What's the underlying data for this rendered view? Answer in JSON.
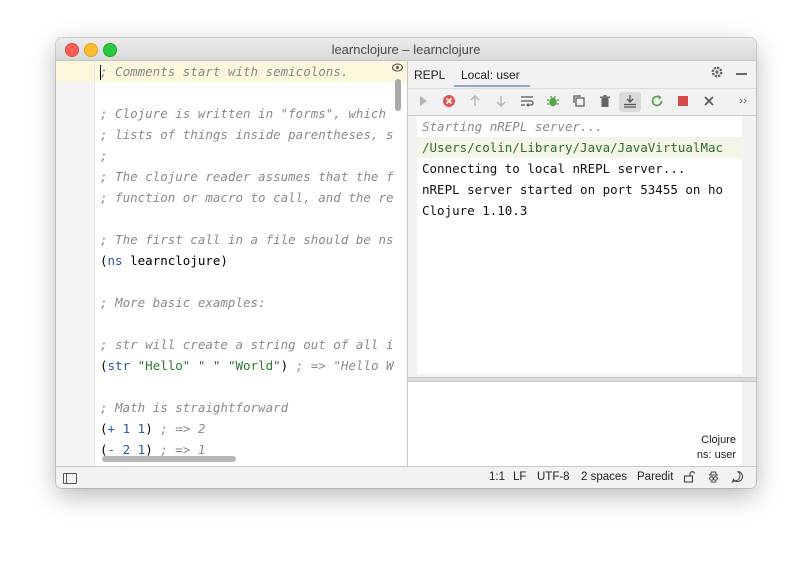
{
  "window": {
    "title": "learnclojure – learnclojure"
  },
  "editor": {
    "lines": [
      [
        {
          "c": "cm",
          "t": "; Comments start with semicolons."
        }
      ],
      [],
      [
        {
          "c": "cm",
          "t": "; Clojure is written in \"forms\", which"
        }
      ],
      [
        {
          "c": "cm",
          "t": "; lists of things inside parentheses, s"
        }
      ],
      [
        {
          "c": "cm",
          "t": ";"
        }
      ],
      [
        {
          "c": "cm",
          "t": "; The clojure reader assumes that the f"
        }
      ],
      [
        {
          "c": "cm",
          "t": "; function or macro to call, and the re"
        }
      ],
      [],
      [
        {
          "c": "cm",
          "t": "; The first call in a file should be ns"
        }
      ],
      [
        {
          "c": "p",
          "t": "("
        },
        {
          "c": "kw",
          "t": "ns"
        },
        {
          "c": "p",
          "t": " learnclojure)"
        }
      ],
      [],
      [
        {
          "c": "cm",
          "t": "; More basic examples:"
        }
      ],
      [],
      [
        {
          "c": "cm",
          "t": "; str will create a string out of all i"
        }
      ],
      [
        {
          "c": "p",
          "t": "("
        },
        {
          "c": "kw",
          "t": "str"
        },
        {
          "c": "p",
          "t": " "
        },
        {
          "c": "st",
          "t": "\"Hello\""
        },
        {
          "c": "p",
          "t": " "
        },
        {
          "c": "st",
          "t": "\" \""
        },
        {
          "c": "p",
          "t": " "
        },
        {
          "c": "st",
          "t": "\"World\""
        },
        {
          "c": "p",
          "t": ") "
        },
        {
          "c": "cm",
          "t": "; => \"Hello W"
        }
      ],
      [],
      [
        {
          "c": "cm",
          "t": "; Math is straightforward"
        }
      ],
      [
        {
          "c": "p",
          "t": "("
        },
        {
          "c": "kw",
          "t": "+"
        },
        {
          "c": "p",
          "t": " "
        },
        {
          "c": "nm",
          "t": "1"
        },
        {
          "c": "p",
          "t": " "
        },
        {
          "c": "nm",
          "t": "1"
        },
        {
          "c": "p",
          "t": ") "
        },
        {
          "c": "cm",
          "t": "; => 2"
        }
      ],
      [
        {
          "c": "p",
          "t": "("
        },
        {
          "c": "kw",
          "t": "-"
        },
        {
          "c": "p",
          "t": " "
        },
        {
          "c": "nm",
          "t": "2"
        },
        {
          "c": "p",
          "t": " "
        },
        {
          "c": "nm",
          "t": "1"
        },
        {
          "c": "p",
          "t": ") "
        },
        {
          "c": "cm",
          "t": "; => 1"
        }
      ]
    ]
  },
  "repl": {
    "tab_repl": "REPL",
    "tab_local": "Local: user",
    "toolbar_icons": [
      "run-icon",
      "stop-error-icon",
      "arrow-up-icon",
      "arrow-down-icon",
      "soft-wrap-icon",
      "debug-bug-icon",
      "copy-icon",
      "trash-icon",
      "scroll-to-end-icon",
      "reload-icon",
      "stop-icon",
      "close-icon",
      "more-icon"
    ],
    "output": [
      {
        "style": "o-italic",
        "text": "Starting nREPL server..."
      },
      {
        "style": "o-path",
        "text": "/Users/colin/Library/Java/JavaVirtualMac"
      },
      {
        "style": "o-norm",
        "text": "Connecting to local nREPL server..."
      },
      {
        "style": "o-norm",
        "text": "nREPL server started on port 53455 on ho"
      },
      {
        "style": "o-norm",
        "text": "Clojure 1.10.3"
      }
    ],
    "ns_label_1": "Clojure",
    "ns_label_2": "ns: user"
  },
  "status": {
    "position": "1:1",
    "line_sep": "LF",
    "encoding": "UTF-8",
    "indent": "2 spaces",
    "mode": "Paredit"
  }
}
